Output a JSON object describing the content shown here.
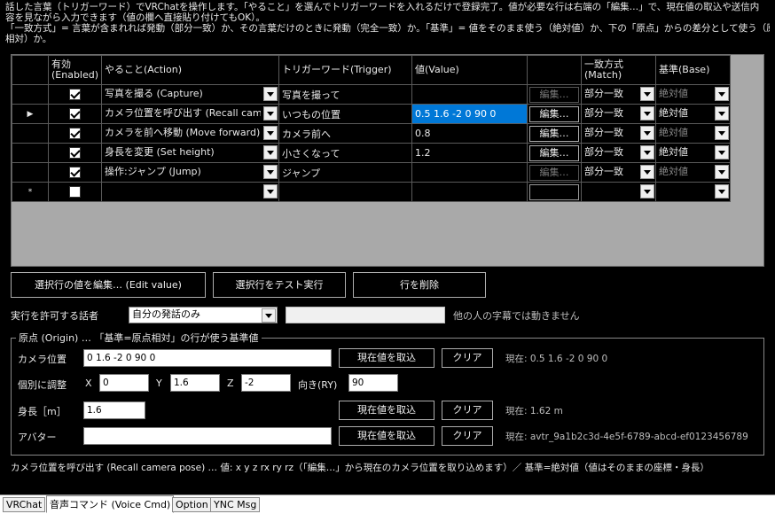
{
  "description": {
    "line1": "話した言葉（トリガーワード）でVRChatを操作します。「やること」を選んでトリガーワードを入れるだけで登録完了。値が必要な行は右端の「編集…」で、現在値の取込や送信内",
    "line2": "容を見ながら入力できます（値の欄へ直接貼り付けてもOK）。",
    "line3": "「一致方式」= 言葉が含まれれば発動（部分一致）か、その言葉だけのときに発動（完全一致）か。「基準」= 値をそのまま使う（絶対値）か、下の「原点」からの差分として使う（原点",
    "line4": "相対）か。"
  },
  "grid": {
    "headers": {
      "enabled": "有効\n(Enabled)",
      "action": "やること(Action)",
      "trigger": "トリガーワード(Trigger)",
      "value": "値(Value)",
      "edit": "",
      "match": "一致方式\n(Match)",
      "base": "基準(Base)"
    },
    "rows": [
      {
        "marker": "",
        "enabled": true,
        "action": "写真を撮る (Capture)",
        "trigger": "写真を撮って",
        "value": "",
        "edit": "編集…",
        "edit_enabled": false,
        "match": "部分一致",
        "base": "絶対値",
        "base_enabled": false
      },
      {
        "marker": "▶",
        "enabled": true,
        "action": "カメラ位置を呼び出す (Recall cam…",
        "trigger": "いつもの位置",
        "value": "0.5 1.6 -2 0 90 0",
        "edit": "編集…",
        "edit_enabled": true,
        "match": "部分一致",
        "base": "絶対値",
        "base_enabled": true,
        "selected": true
      },
      {
        "marker": "",
        "enabled": true,
        "action": "カメラを前へ移動 (Move forward)",
        "trigger": "カメラ前へ",
        "value": "0.8",
        "edit": "編集…",
        "edit_enabled": true,
        "match": "部分一致",
        "base": "絶対値",
        "base_enabled": false
      },
      {
        "marker": "",
        "enabled": true,
        "action": "身長を変更 (Set height)",
        "trigger": "小さくなって",
        "value": "1.2",
        "edit": "編集…",
        "edit_enabled": true,
        "match": "部分一致",
        "base": "絶対値",
        "base_enabled": true
      },
      {
        "marker": "",
        "enabled": true,
        "action": "操作:ジャンプ (Jump)",
        "trigger": "ジャンプ",
        "value": "",
        "edit": "編集…",
        "edit_enabled": false,
        "match": "部分一致",
        "base": "絶対値",
        "base_enabled": false
      },
      {
        "marker": "*",
        "enabled": false,
        "action": "",
        "trigger": "",
        "value": "",
        "edit": "",
        "edit_enabled": false,
        "match": "",
        "base": "",
        "base_enabled": false,
        "new_row": true
      }
    ]
  },
  "buttons": {
    "edit_value": "選択行の値を編集… (Edit value)",
    "test_run": "選択行をテスト実行",
    "delete_row": "行を削除"
  },
  "speaker": {
    "label": "実行を許可する話者",
    "selected": "自分の発話のみ",
    "textbox": "",
    "note": "他の人の字幕では動きません"
  },
  "origin": {
    "title": "原点 (Origin) … 「基準=原点相対」の行が使う基準値",
    "camera_label": "カメラ位置",
    "camera_value": "0 1.6 -2 0 90 0",
    "adjust_label": "個別に調整",
    "x_label": "X",
    "x_value": "0",
    "y_label": "Y",
    "y_value": "1.6",
    "z_label": "Z",
    "z_value": "-2",
    "ry_label": "向き(RY)",
    "ry_value": "90",
    "height_label": "身長［m］",
    "height_value": "1.6",
    "avatar_label": "アバター",
    "avatar_value": "",
    "capture_label": "現在値を取込",
    "clear_label": "クリア",
    "current_camera": "現在: 0.5 1.6 -2 0 90 0",
    "current_height": "現在: 1.62 m",
    "current_avatar": "現在: avtr_9a1b2c3d-4e5f-6789-abcd-ef0123456789"
  },
  "hint": "カメラ位置を呼び出す (Recall camera pose) … 値: x y z rx ry rz（「編集…」から現在のカメラ位置を取り込めます）／ 基準=絶対値（値はそのままの座標・身長）",
  "tabs": [
    {
      "label": "VRChat",
      "active": false
    },
    {
      "label": "音声コマンド (Voice Cmd)",
      "active": true
    },
    {
      "label": "Option",
      "active": false
    },
    {
      "label": "YNC Msg",
      "active": false
    }
  ]
}
